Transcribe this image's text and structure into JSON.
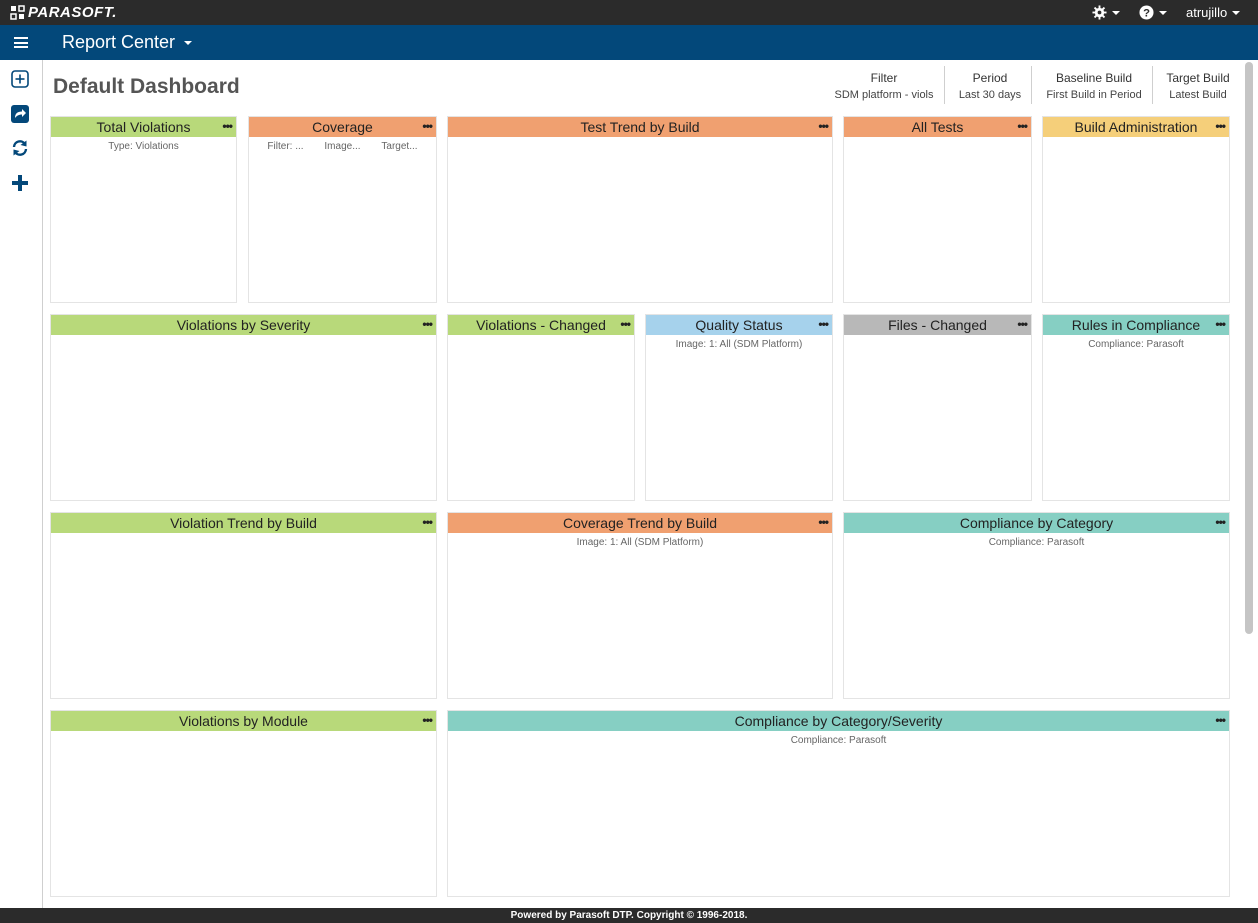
{
  "brand": {
    "name": "PARASOFT."
  },
  "topbar": {
    "user": "atrujillo"
  },
  "navbar": {
    "title": "Report Center"
  },
  "page": {
    "title": "Default Dashboard"
  },
  "header_groups": [
    {
      "label": "Filter",
      "value": "SDM platform - viols"
    },
    {
      "label": "Period",
      "value": "Last 30 days"
    },
    {
      "label": "Baseline Build",
      "value": "First Build in Period"
    },
    {
      "label": "Target Build",
      "value": "Latest Build"
    }
  ],
  "widgets": {
    "total_violations": {
      "title": "Total Violations",
      "sub": "Type: Violations"
    },
    "coverage": {
      "title": "Coverage",
      "cols": [
        "Filter: ...",
        "Image...",
        "Target..."
      ]
    },
    "test_trend": {
      "title": "Test Trend by Build"
    },
    "all_tests": {
      "title": "All Tests"
    },
    "build_admin": {
      "title": "Build Administration"
    },
    "viol_severity": {
      "title": "Violations by Severity"
    },
    "viol_changed": {
      "title": "Violations - Changed"
    },
    "quality_status": {
      "title": "Quality Status",
      "sub": "Image: 1: All (SDM Platform)"
    },
    "files_changed": {
      "title": "Files - Changed"
    },
    "rules_compliance": {
      "title": "Rules in Compliance",
      "sub": "Compliance: Parasoft"
    },
    "viol_trend": {
      "title": "Violation Trend by Build"
    },
    "cov_trend": {
      "title": "Coverage Trend by Build",
      "sub": "Image: 1: All (SDM Platform)"
    },
    "comp_category": {
      "title": "Compliance by Category",
      "sub": "Compliance: Parasoft"
    },
    "viol_module": {
      "title": "Violations by Module"
    },
    "comp_cat_sev": {
      "title": "Compliance by Category/Severity",
      "sub": "Compliance: Parasoft"
    }
  },
  "menu_dots": "•••",
  "footer": {
    "text": "Powered by Parasoft DTP. Copyright © 1996-2018."
  },
  "colors": {
    "green": "#b8d97a",
    "orange": "#f0a070",
    "yellow": "#f5cf7a",
    "blue": "#a6d2ec",
    "gray": "#b8b8b8",
    "teal": "#86cfc3",
    "navbar": "#03487a",
    "topbar": "#2b2b2b"
  }
}
